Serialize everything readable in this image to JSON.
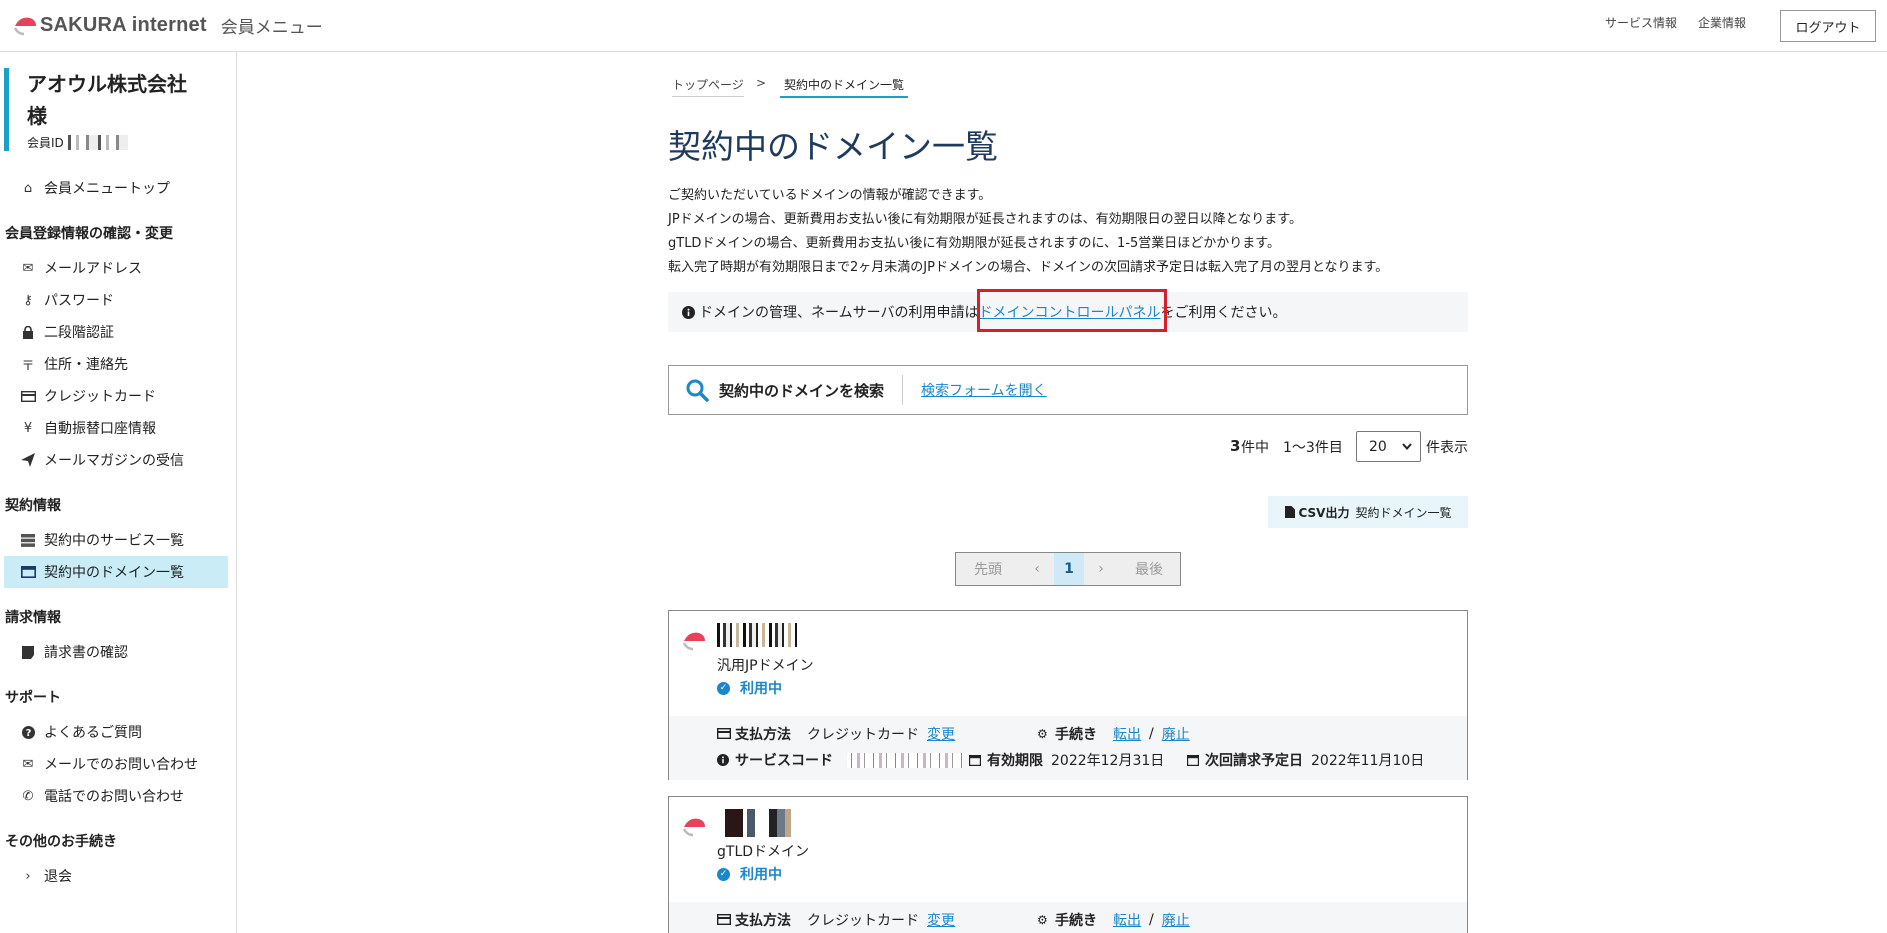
{
  "header": {
    "brand": "SAKURA internet",
    "subtitle": "会員メニュー",
    "nav": [
      "サービス情報",
      "企業情報"
    ],
    "logout": "ログアウト"
  },
  "sidebar": {
    "member_name_line1": "アオウル株式会社",
    "member_name_line2": "様",
    "member_id_label": "会員ID",
    "top_item": "会員メニュートップ",
    "sections": [
      {
        "title": "会員登録情報の確認・変更",
        "items": [
          "メールアドレス",
          "パスワード",
          "二段階認証",
          "住所・連絡先",
          "クレジットカード",
          "自動振替口座情報",
          "メールマガジンの受信"
        ]
      },
      {
        "title": "契約情報",
        "items": [
          "契約中のサービス一覧",
          "契約中のドメイン一覧"
        ]
      },
      {
        "title": "請求情報",
        "items": [
          "請求書の確認"
        ]
      },
      {
        "title": "サポート",
        "items": [
          "よくあるご質問",
          "メールでのお問い合わせ",
          "電話でのお問い合わせ"
        ]
      },
      {
        "title": "その他のお手続き",
        "items": [
          "退会"
        ]
      }
    ]
  },
  "breadcrumb": {
    "home": "トップページ",
    "sep": ">",
    "current": "契約中のドメイン一覧"
  },
  "main": {
    "title": "契約中のドメイン一覧",
    "desc": [
      "ご契約いただいているドメインの情報が確認できます。",
      "JPドメインの場合、更新費用お支払い後に有効期限が延長されますのは、有効期限日の翌日以降となります。",
      "gTLDドメインの場合、更新費用お支払い後に有効期限が延長されますのに、1-5営業日ほどかかります。",
      "転入完了時期が有効期限日まで2ヶ月未満のJPドメインの場合、ドメインの次回請求予定日は転入完了月の翌月となります。"
    ],
    "notice_before": "ドメインの管理、ネームサーバの利用申請は",
    "notice_link": "ドメインコントロールパネル",
    "notice_after": "をご利用ください。",
    "search_label": "契約中のドメインを検索",
    "search_link": "検索フォームを開く",
    "count_num": "3",
    "count_unit": "件中",
    "count_range": "1～3件目",
    "per_page": "20",
    "per_page_suffix": "件表示",
    "csv_label": "CSV出力",
    "csv_target": "契約ドメイン一覧",
    "pager": {
      "first": "先頭",
      "prev": "‹",
      "current": "1",
      "next": "›",
      "last": "最後"
    }
  },
  "cards": [
    {
      "type": "汎用JPドメイン",
      "status": "利用中",
      "pay_label": "支払方法",
      "pay_value": "クレジットカード",
      "pay_change": "変更",
      "proc_label": "手続き",
      "proc_out": "転出",
      "proc_slash": "/",
      "proc_cancel": "廃止",
      "code_label": "サービスコード",
      "expire_label": "有効期限",
      "expire_value": "2022年12月31日",
      "bill_label": "次回請求予定日",
      "bill_value": "2022年11月10日"
    },
    {
      "type": "gTLDドメイン",
      "status": "利用中",
      "pay_label": "支払方法",
      "pay_value": "クレジットカード",
      "pay_change": "変更",
      "proc_label": "手続き",
      "proc_out": "転出",
      "proc_slash": "/",
      "proc_cancel": "廃止"
    }
  ],
  "colors": {
    "accent": "#1b87c9",
    "active_bg": "#c9ecf7",
    "highlight": "#d51f2a",
    "member_bar": "#1ba0c8"
  }
}
